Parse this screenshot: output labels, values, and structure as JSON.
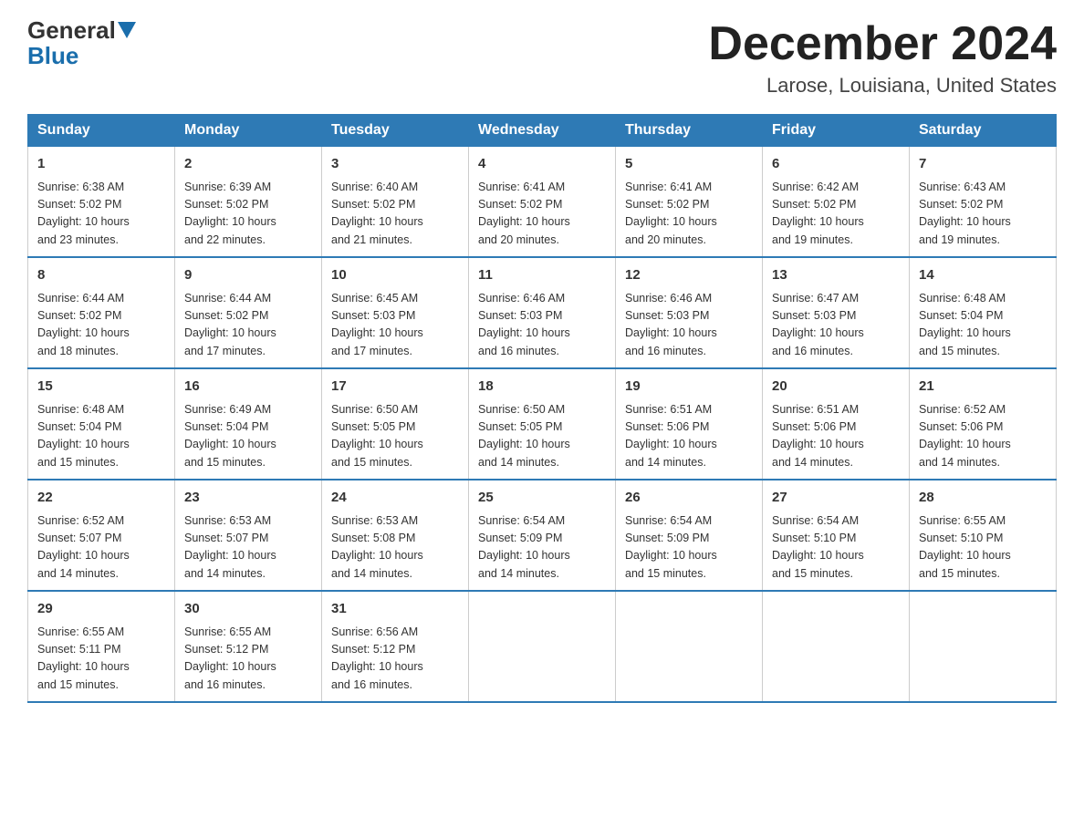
{
  "header": {
    "logo_general": "General",
    "logo_blue": "Blue",
    "month_title": "December 2024",
    "location": "Larose, Louisiana, United States"
  },
  "days_of_week": [
    "Sunday",
    "Monday",
    "Tuesday",
    "Wednesday",
    "Thursday",
    "Friday",
    "Saturday"
  ],
  "weeks": [
    [
      {
        "day": "1",
        "sunrise": "6:38 AM",
        "sunset": "5:02 PM",
        "daylight": "10 hours and 23 minutes."
      },
      {
        "day": "2",
        "sunrise": "6:39 AM",
        "sunset": "5:02 PM",
        "daylight": "10 hours and 22 minutes."
      },
      {
        "day": "3",
        "sunrise": "6:40 AM",
        "sunset": "5:02 PM",
        "daylight": "10 hours and 21 minutes."
      },
      {
        "day": "4",
        "sunrise": "6:41 AM",
        "sunset": "5:02 PM",
        "daylight": "10 hours and 20 minutes."
      },
      {
        "day": "5",
        "sunrise": "6:41 AM",
        "sunset": "5:02 PM",
        "daylight": "10 hours and 20 minutes."
      },
      {
        "day": "6",
        "sunrise": "6:42 AM",
        "sunset": "5:02 PM",
        "daylight": "10 hours and 19 minutes."
      },
      {
        "day": "7",
        "sunrise": "6:43 AM",
        "sunset": "5:02 PM",
        "daylight": "10 hours and 19 minutes."
      }
    ],
    [
      {
        "day": "8",
        "sunrise": "6:44 AM",
        "sunset": "5:02 PM",
        "daylight": "10 hours and 18 minutes."
      },
      {
        "day": "9",
        "sunrise": "6:44 AM",
        "sunset": "5:02 PM",
        "daylight": "10 hours and 17 minutes."
      },
      {
        "day": "10",
        "sunrise": "6:45 AM",
        "sunset": "5:03 PM",
        "daylight": "10 hours and 17 minutes."
      },
      {
        "day": "11",
        "sunrise": "6:46 AM",
        "sunset": "5:03 PM",
        "daylight": "10 hours and 16 minutes."
      },
      {
        "day": "12",
        "sunrise": "6:46 AM",
        "sunset": "5:03 PM",
        "daylight": "10 hours and 16 minutes."
      },
      {
        "day": "13",
        "sunrise": "6:47 AM",
        "sunset": "5:03 PM",
        "daylight": "10 hours and 16 minutes."
      },
      {
        "day": "14",
        "sunrise": "6:48 AM",
        "sunset": "5:04 PM",
        "daylight": "10 hours and 15 minutes."
      }
    ],
    [
      {
        "day": "15",
        "sunrise": "6:48 AM",
        "sunset": "5:04 PM",
        "daylight": "10 hours and 15 minutes."
      },
      {
        "day": "16",
        "sunrise": "6:49 AM",
        "sunset": "5:04 PM",
        "daylight": "10 hours and 15 minutes."
      },
      {
        "day": "17",
        "sunrise": "6:50 AM",
        "sunset": "5:05 PM",
        "daylight": "10 hours and 15 minutes."
      },
      {
        "day": "18",
        "sunrise": "6:50 AM",
        "sunset": "5:05 PM",
        "daylight": "10 hours and 14 minutes."
      },
      {
        "day": "19",
        "sunrise": "6:51 AM",
        "sunset": "5:06 PM",
        "daylight": "10 hours and 14 minutes."
      },
      {
        "day": "20",
        "sunrise": "6:51 AM",
        "sunset": "5:06 PM",
        "daylight": "10 hours and 14 minutes."
      },
      {
        "day": "21",
        "sunrise": "6:52 AM",
        "sunset": "5:06 PM",
        "daylight": "10 hours and 14 minutes."
      }
    ],
    [
      {
        "day": "22",
        "sunrise": "6:52 AM",
        "sunset": "5:07 PM",
        "daylight": "10 hours and 14 minutes."
      },
      {
        "day": "23",
        "sunrise": "6:53 AM",
        "sunset": "5:07 PM",
        "daylight": "10 hours and 14 minutes."
      },
      {
        "day": "24",
        "sunrise": "6:53 AM",
        "sunset": "5:08 PM",
        "daylight": "10 hours and 14 minutes."
      },
      {
        "day": "25",
        "sunrise": "6:54 AM",
        "sunset": "5:09 PM",
        "daylight": "10 hours and 14 minutes."
      },
      {
        "day": "26",
        "sunrise": "6:54 AM",
        "sunset": "5:09 PM",
        "daylight": "10 hours and 15 minutes."
      },
      {
        "day": "27",
        "sunrise": "6:54 AM",
        "sunset": "5:10 PM",
        "daylight": "10 hours and 15 minutes."
      },
      {
        "day": "28",
        "sunrise": "6:55 AM",
        "sunset": "5:10 PM",
        "daylight": "10 hours and 15 minutes."
      }
    ],
    [
      {
        "day": "29",
        "sunrise": "6:55 AM",
        "sunset": "5:11 PM",
        "daylight": "10 hours and 15 minutes."
      },
      {
        "day": "30",
        "sunrise": "6:55 AM",
        "sunset": "5:12 PM",
        "daylight": "10 hours and 16 minutes."
      },
      {
        "day": "31",
        "sunrise": "6:56 AM",
        "sunset": "5:12 PM",
        "daylight": "10 hours and 16 minutes."
      },
      null,
      null,
      null,
      null
    ]
  ],
  "labels": {
    "sunrise": "Sunrise:",
    "sunset": "Sunset:",
    "daylight": "Daylight:"
  }
}
